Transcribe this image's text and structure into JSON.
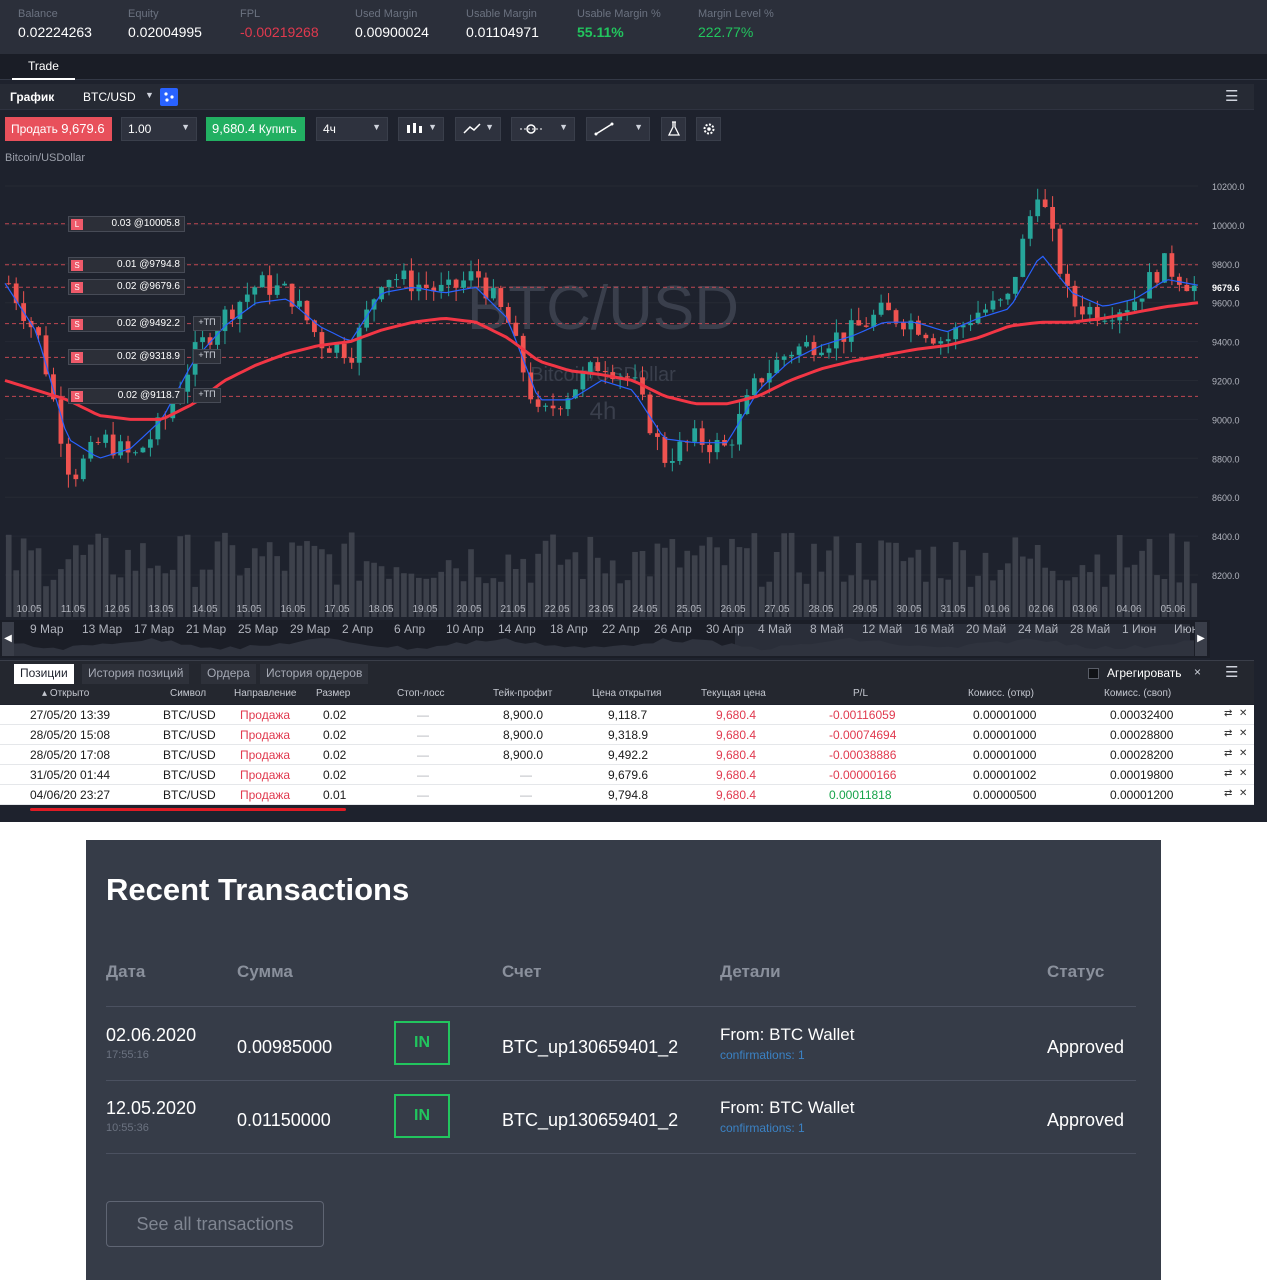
{
  "account": {
    "items": [
      {
        "label": "Balance",
        "value": "0.02224263",
        "color": "#ffffff"
      },
      {
        "label": "Equity",
        "value": "0.02004995",
        "color": "#ffffff"
      },
      {
        "label": "FPL",
        "value": "-0.00219268",
        "color": "#e0394e"
      },
      {
        "label": "Used Margin",
        "value": "0.00900024",
        "color": "#ffffff"
      },
      {
        "label": "Usable Margin",
        "value": "0.01104971",
        "color": "#ffffff"
      },
      {
        "label": "Usable Margin %",
        "value": "55.11%",
        "color": "#22c55e"
      },
      {
        "label": "Margin Level %",
        "value": "222.77%",
        "color": "#22c55e"
      }
    ]
  },
  "tabs": {
    "trade": "Trade"
  },
  "chart_header": {
    "title": "График",
    "symbol": "BTC/USD"
  },
  "toolbar": {
    "sell_label": "Продать",
    "sell_price": "9,679.6",
    "quantity": "1.00",
    "buy_price": "9,680.4",
    "buy_label": "Купить",
    "timeframe": "4ч"
  },
  "chart_data": {
    "type": "candlestick",
    "instrument": "Bitcoin/USDollar",
    "watermark_symbol": "BTC/USD",
    "watermark_name": "Bitcoin/USDollar",
    "watermark_tf": "4h",
    "price_axis": [
      10200.0,
      10000.0,
      9800.0,
      9600.0,
      9400.0,
      9200.0,
      9000.0,
      8800.0,
      8600.0,
      8400.0,
      8200.0
    ],
    "price_axis_labels": [
      "10200.0",
      "10000.0",
      "9800.0",
      "9600.0",
      "9400.0",
      "9200.0",
      "9000.0",
      "8800.0",
      "8600.0",
      "8400.0",
      "8200.0"
    ],
    "current_price": "9679.6",
    "ylim": [
      8130,
      10380
    ],
    "x_dates": [
      "10.05",
      "11.05",
      "12.05",
      "13.05",
      "14.05",
      "15.05",
      "16.05",
      "17.05",
      "18.05",
      "19.05",
      "20.05",
      "21.05",
      "22.05",
      "23.05",
      "24.05",
      "25.05",
      "26.05",
      "27.05",
      "28.05",
      "29.05",
      "30.05",
      "31.05",
      "01.06",
      "02.06",
      "03.06",
      "04.06",
      "05.06"
    ],
    "navigator_labels": [
      "9 Мар",
      "13 Мар",
      "17 Мар",
      "21 Мар",
      "25 Мар",
      "29 Мар",
      "2 Апр",
      "6 Апр",
      "10 Апр",
      "14 Апр",
      "18 Апр",
      "22 Апр",
      "26 Апр",
      "30 Апр",
      "4 Май",
      "8 Май",
      "12 Май",
      "16 Май",
      "20 Май",
      "24 Май",
      "28 Май",
      "1 Июн",
      "Июн"
    ],
    "close_path": [
      9700,
      9400,
      8700,
      8900,
      8800,
      9000,
      9350,
      9550,
      9700,
      9650,
      9400,
      9350,
      9750,
      9700,
      9650,
      9750,
      9500,
      9000,
      9150,
      9300,
      9200,
      8800,
      8900,
      8850,
      9200,
      9350,
      9400,
      9450,
      9550,
      9500,
      9400,
      9550,
      9600,
      10200,
      9600,
      9550,
      9600,
      9800,
      9680
    ],
    "ema_fast_path": [
      9700,
      9450,
      8900,
      8800,
      8850,
      9000,
      9300,
      9480,
      9600,
      9620,
      9480,
      9400,
      9650,
      9680,
      9650,
      9680,
      9520,
      9100,
      9100,
      9200,
      9150,
      8900,
      8880,
      8880,
      9150,
      9300,
      9380,
      9430,
      9500,
      9500,
      9450,
      9520,
      9570,
      9850,
      9650,
      9580,
      9620,
      9720,
      9690
    ],
    "ema_slow_path": [
      9200,
      9150,
      9100,
      9020,
      9000,
      9000,
      9080,
      9200,
      9280,
      9340,
      9380,
      9400,
      9460,
      9500,
      9520,
      9500,
      9420,
      9300,
      9250,
      9230,
      9200,
      9120,
      9080,
      9080,
      9120,
      9200,
      9260,
      9300,
      9330,
      9360,
      9380,
      9420,
      9480,
      9500,
      9500,
      9520,
      9550,
      9580,
      9600
    ],
    "orders": [
      {
        "tag": "L",
        "label": "0.03 @10005.8",
        "price": 10005.8,
        "tp": false
      },
      {
        "tag": "S",
        "label": "0.01 @9794.8",
        "price": 9794.8,
        "tp": false
      },
      {
        "tag": "S",
        "label": "0.02 @9679.6",
        "price": 9679.6,
        "tp": false
      },
      {
        "tag": "S",
        "label": "0.02 @9492.2",
        "price": 9492.2,
        "tp": true
      },
      {
        "tag": "S",
        "label": "0.02 @9318.9",
        "price": 9318.9,
        "tp": true
      },
      {
        "tag": "S",
        "label": "0.02 @9118.7",
        "price": 9118.7,
        "tp": true
      }
    ],
    "tp_label": "+ТП"
  },
  "positions": {
    "tabs": [
      "Позиции",
      "История позиций",
      "Ордера",
      "История ордеров"
    ],
    "aggregate_label": "Агрегировать",
    "columns": [
      "Открыто",
      "Символ",
      "Направление",
      "Размер",
      "Стоп-лосс",
      "Тейк-профит",
      "Цена открытия",
      "Текущая цена",
      "P/L",
      "Комисс. (откр)",
      "Комисс. (своп)"
    ],
    "rows": [
      {
        "opened": "27/05/20 13:39",
        "symbol": "BTC/USD",
        "side": "Продажа",
        "size": "0.02",
        "sl": "—",
        "tp": "8,900.0",
        "open_price": "9,118.7",
        "cur_price": "9,680.4",
        "pl": "-0.00116059",
        "pl_color": "#e0394e",
        "comm_open": "0.00001000",
        "comm_swap": "0.00032400"
      },
      {
        "opened": "28/05/20 15:08",
        "symbol": "BTC/USD",
        "side": "Продажа",
        "size": "0.02",
        "sl": "—",
        "tp": "8,900.0",
        "open_price": "9,318.9",
        "cur_price": "9,680.4",
        "pl": "-0.00074694",
        "pl_color": "#e0394e",
        "comm_open": "0.00001000",
        "comm_swap": "0.00028800"
      },
      {
        "opened": "28/05/20 17:08",
        "symbol": "BTC/USD",
        "side": "Продажа",
        "size": "0.02",
        "sl": "—",
        "tp": "8,900.0",
        "open_price": "9,492.2",
        "cur_price": "9,680.4",
        "pl": "-0.00038886",
        "pl_color": "#e0394e",
        "comm_open": "0.00001000",
        "comm_swap": "0.00028200"
      },
      {
        "opened": "31/05/20 01:44",
        "symbol": "BTC/USD",
        "side": "Продажа",
        "size": "0.02",
        "sl": "—",
        "tp": "—",
        "open_price": "9,679.6",
        "cur_price": "9,680.4",
        "pl": "-0.00000166",
        "pl_color": "#e0394e",
        "comm_open": "0.00001002",
        "comm_swap": "0.00019800"
      },
      {
        "opened": "04/06/20 23:27",
        "symbol": "BTC/USD",
        "side": "Продажа",
        "size": "0.01",
        "sl": "—",
        "tp": "—",
        "open_price": "9,794.8",
        "cur_price": "9,680.4",
        "pl": "0.00011818",
        "pl_color": "#16a34a",
        "comm_open": "0.00000500",
        "comm_swap": "0.00001200"
      }
    ]
  },
  "transactions": {
    "title": "Recent Transactions",
    "headers": {
      "date": "Дата",
      "amount": "Сумма",
      "account": "Счет",
      "details": "Детали",
      "status": "Статус"
    },
    "rows": [
      {
        "date": "02.06.2020",
        "time": "17:55:16",
        "amount": "0.00985000",
        "direction": "IN",
        "account": "BTC_up130659401_2",
        "details": "From: BTC Wallet",
        "confirmations": "confirmations: 1",
        "status": "Approved"
      },
      {
        "date": "12.05.2020",
        "time": "10:55:36",
        "amount": "0.01150000",
        "direction": "IN",
        "account": "BTC_up130659401_2",
        "details": "From: BTC Wallet",
        "confirmations": "confirmations: 1",
        "status": "Approved"
      }
    ],
    "see_all": "See all transactions"
  },
  "colors": {
    "bull": "#26a69a",
    "bear": "#ef5350",
    "ema_fast": "#2962ff",
    "ema_slow": "#f23645",
    "accent_sell": "#e8505b",
    "accent_buy": "#22b062"
  }
}
